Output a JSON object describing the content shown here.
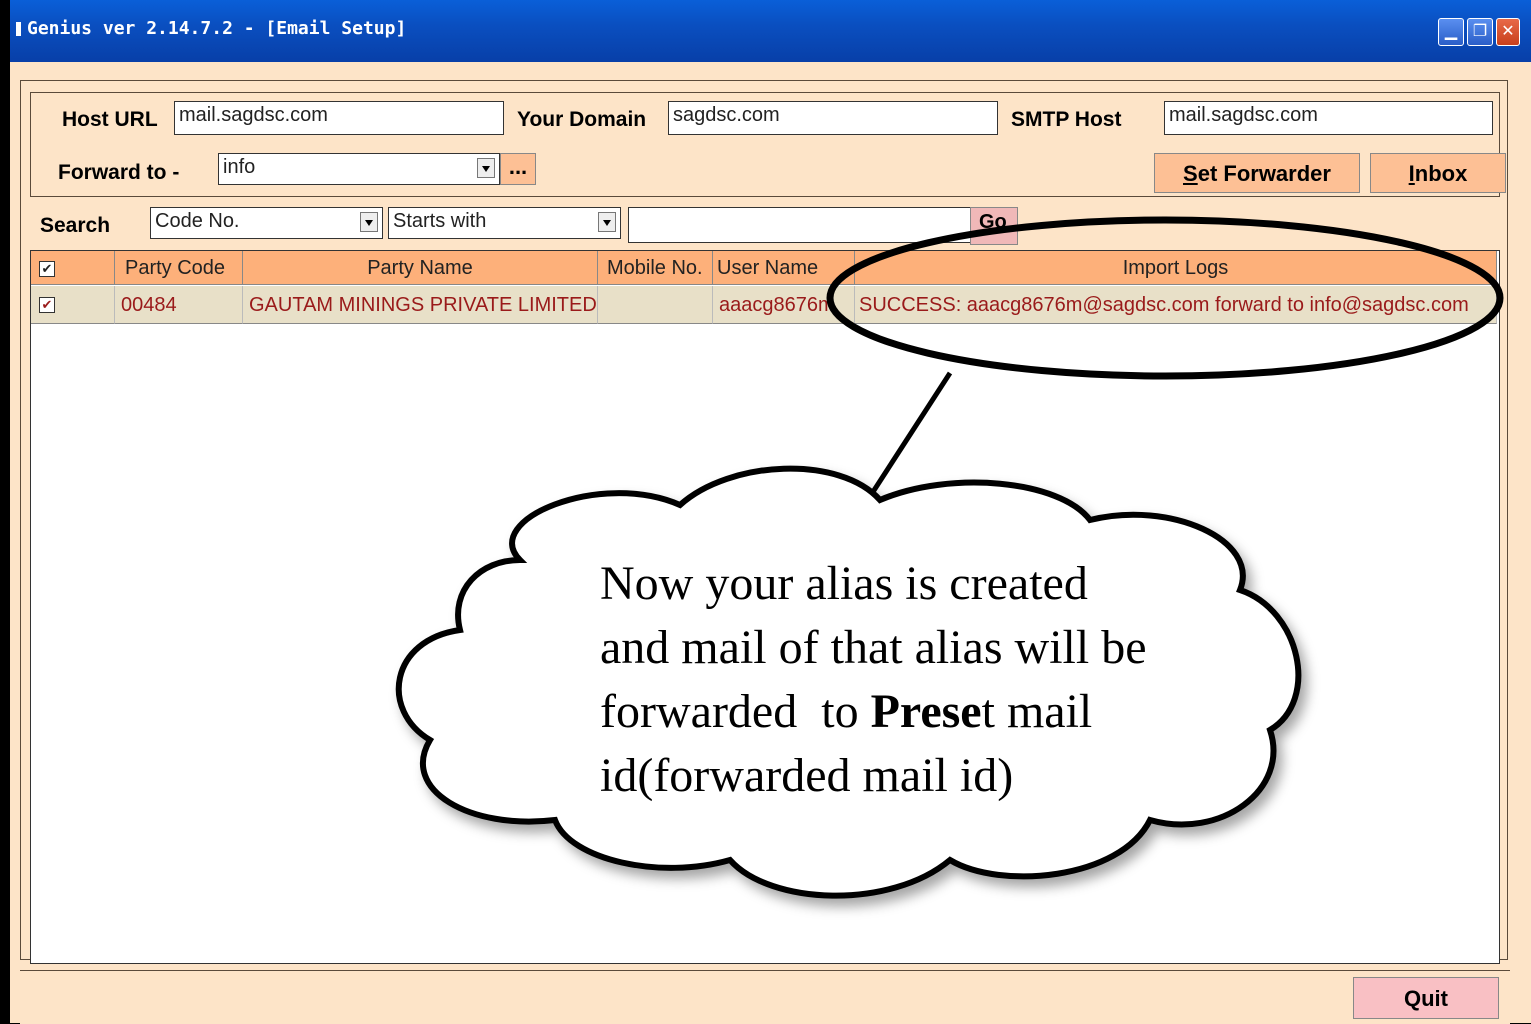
{
  "window": {
    "title": "Genius ver 2.14.7.2 - [Email Setup]"
  },
  "form": {
    "host_url_label": "Host URL",
    "host_url_value": "mail.sagdsc.com",
    "your_domain_label": "Your Domain",
    "your_domain_value": "sagdsc.com",
    "smtp_host_label": "SMTP Host",
    "smtp_host_value": "mail.sagdsc.com",
    "forward_to_label": "Forward to -",
    "forward_to_value": "info",
    "ellipsis_label": "...",
    "set_forwarder_rest": "et Forwarder",
    "set_forwarder_key": "S",
    "inbox_key": "I",
    "inbox_rest": "nbox"
  },
  "search": {
    "label": "Search",
    "field_value": "Code No.",
    "mode_value": "Starts with",
    "query": "",
    "go_label": "Go"
  },
  "table": {
    "columns": [
      "Party Code",
      "Party Name",
      "Mobile No.",
      "User Name",
      "Import Logs"
    ],
    "rows": [
      {
        "party_code": "00484",
        "party_name": "GAUTAM MININGS PRIVATE LIMITED",
        "mobile": "",
        "user_name": "aaacg8676m",
        "import_log": "SUCCESS: aaacg8676m@sagdsc.com forward to info@sagdsc.com"
      }
    ]
  },
  "footer": {
    "quit_label": "Quit"
  },
  "annotation": {
    "line1": "Now your alias is created",
    "line2": "and mail of that alias will be",
    "line3_a": "forwarded  to ",
    "line3_bold": "Prese",
    "line3_b": "t mail",
    "line4": "id(forwarded mail id)"
  },
  "colors": {
    "titlebar": "#0a4fc0",
    "background": "#fde4c8",
    "header": "#fdb07a",
    "row_text": "#9a1a1a"
  }
}
